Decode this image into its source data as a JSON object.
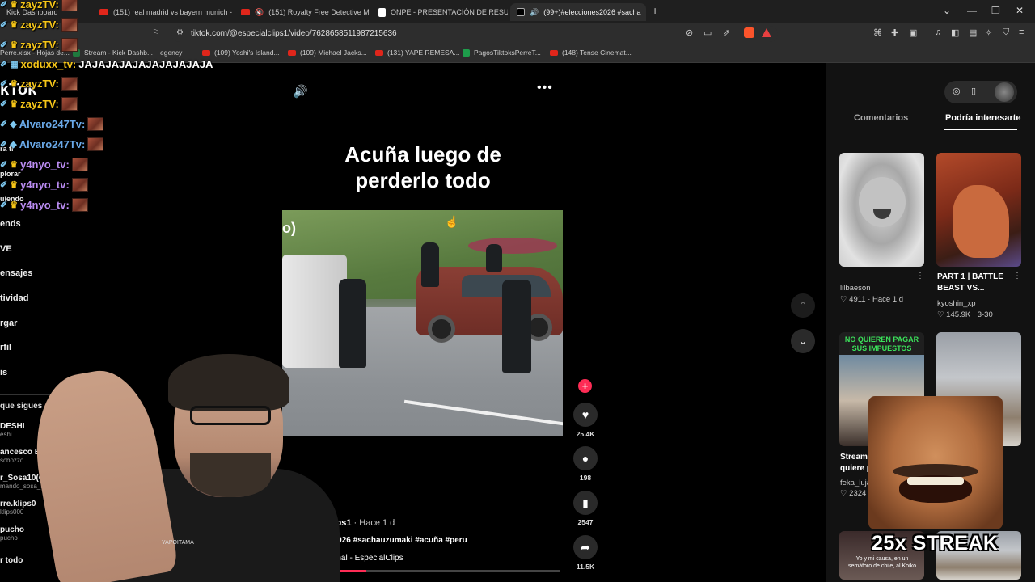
{
  "browser": {
    "tabs": [
      {
        "label": "Kick Dashboard",
        "type": "kick"
      },
      {
        "label": "(151) real madrid vs bayern munich -",
        "type": "youtube"
      },
      {
        "label": "(151) Royalty Free Detective Musi",
        "type": "youtube"
      },
      {
        "label": "ONPE - PRESENTACIÓN DE RESULTA",
        "type": "doc"
      },
      {
        "label": "(99+)#elecciones2026 #sacha",
        "type": "tiktok"
      }
    ],
    "url": "tiktok.com/@especialclips1/video/7628658511987215636",
    "bookmarks": [
      "Perre.xlsx - Hojas de...",
      "Stream - Kick Dashb...",
      "egency",
      "(109) Yoshi's Island...",
      "(109) Michael Jacks...",
      "(131) YAPE REMESA...",
      "PagosTiktoksPerreT...",
      "(148) Tense Cinemat..."
    ]
  },
  "sidebar": {
    "brand": "kTok",
    "items": [
      "ra ti",
      "plorar",
      "uiendo",
      "ends",
      "VE",
      "ensajes",
      "tividad",
      "rgar",
      "rfil",
      "is"
    ],
    "following_header": "que sigues",
    "accounts": [
      {
        "name": "DESHI",
        "handle": "eshi"
      },
      {
        "name": "ancesco Bozzo",
        "handle": "scbozzo"
      },
      {
        "name": "r_Sosa10(GCyosoy)",
        "handle": "mando_sosa_10"
      },
      {
        "name": "rre.klips0",
        "handle": "klips000"
      },
      {
        "name": "pucho",
        "handle": "pucho"
      }
    ],
    "see_all": "r todo"
  },
  "chat": [
    {
      "user": "zayzTV:",
      "color": "#f5c518",
      "badges": "crown",
      "text": ""
    },
    {
      "user": "zayzTV:",
      "color": "#f5c518",
      "badges": "crown",
      "text": ""
    },
    {
      "user": "zayzTV:",
      "color": "#f5c518",
      "badges": "crown",
      "text": ""
    },
    {
      "user": "xoduxx_tv:",
      "color": "#f5c518",
      "badges": "sword",
      "text": "JAJAJAJAJAJAJAJAJAJA"
    },
    {
      "user": "zayzTV:",
      "color": "#f5c518",
      "badges": "crown",
      "text": ""
    },
    {
      "user": "zayzTV:",
      "color": "#f5c518",
      "badges": "crown",
      "text": ""
    },
    {
      "user": "Alvaro247Tv:",
      "color": "#6aa9e8",
      "badges": "gem",
      "text": ""
    },
    {
      "user": "Alvaro247Tv:",
      "color": "#6aa9e8",
      "badges": "gem",
      "text": ""
    },
    {
      "user": "y4nyo_tv:",
      "color": "#b98bf0",
      "badges": "crown",
      "text": ""
    },
    {
      "user": "y4nyo_tv:",
      "color": "#b98bf0",
      "badges": "crown",
      "text": ""
    },
    {
      "user": "y4nyo_tv:",
      "color": "#b98bf0",
      "badges": "crown",
      "text": ""
    }
  ],
  "video": {
    "title_line1": "Acuña luego de",
    "title_line2": "perderlo todo",
    "corner_label": "o)",
    "author": "specialclips1",
    "ago": " · Hace 1 d",
    "hashtags": "lecciones2026 #sachauzumaki #acuña #peru",
    "sound": "nido original - EspecialClips",
    "progress_fraction": 0.22,
    "likes": "25.4K",
    "comments": "198",
    "saves": "2547",
    "shares": "11.5K"
  },
  "right_panel": {
    "tab_comments": "Comentarios",
    "tab_interesting": "Podría interesarte",
    "items": [
      {
        "caption": "",
        "user": "lilbaeson",
        "meta": "♡ 4911 · Hace 1 d"
      },
      {
        "caption_line1": "PART 1 | BATTLE",
        "caption_line2": "BEAST VS...",
        "user": "kyoshin_xp",
        "meta": "♡ 145.9K · 3-30"
      },
      {
        "banner_line1": "NO QUIEREN PAGAR",
        "banner_line2": "SUS IMPUESTOS",
        "caption_line1": "Stream",
        "caption_line2": "quiere p",
        "user": "feka_luja",
        "meta": "♡ 2324"
      },
      {
        "meme_text": "Yo y mi causa, en un semáforo de chile, al Koiko"
      }
    ]
  },
  "overlay": {
    "streak": "25x STREAK",
    "cam_logo": "YAPOITAMA"
  },
  "colors": {
    "accent": "#fe2c55",
    "bg": "#000000",
    "panel": "#121212"
  }
}
